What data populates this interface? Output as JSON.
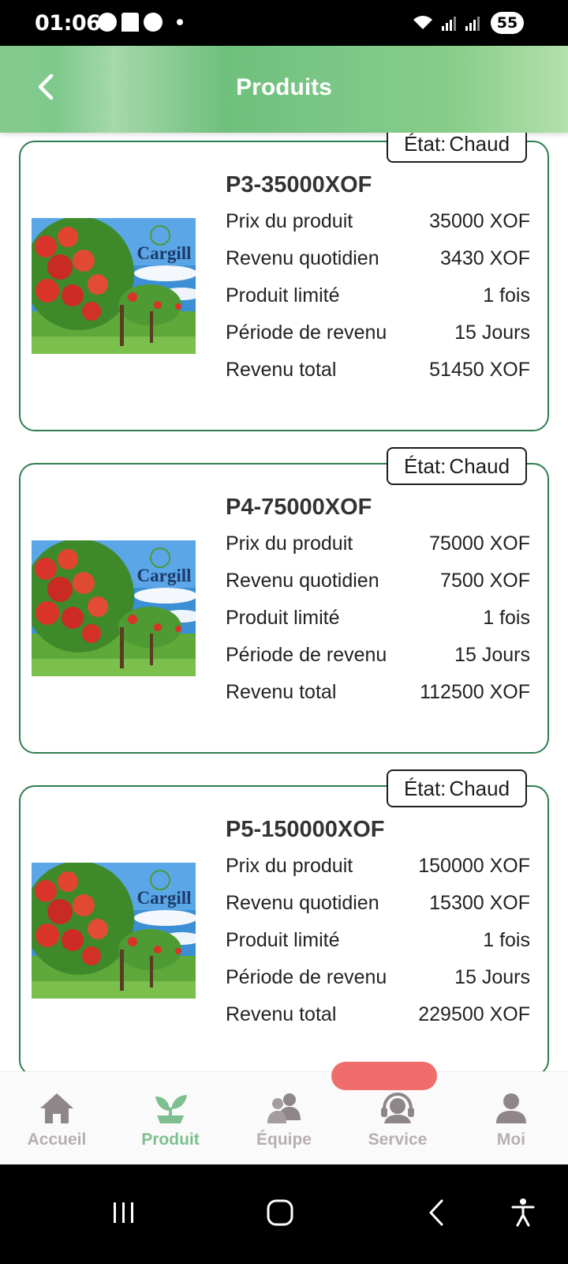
{
  "status_bar": {
    "time": "01:06",
    "battery": "55"
  },
  "header": {
    "title": "Produits"
  },
  "products": [
    {
      "name": "P3-35000XOF",
      "state_label": "État:",
      "state_value": "Chaud",
      "brand": "Cargill",
      "rows": [
        {
          "label": "Prix du produit",
          "value": "35000 XOF"
        },
        {
          "label": "Revenu quotidien",
          "value": "3430 XOF"
        },
        {
          "label": "Produit limité",
          "value": "1 fois"
        },
        {
          "label": "Période de revenu",
          "value": "15 Jours"
        },
        {
          "label": "Revenu total",
          "value": "51450 XOF"
        }
      ]
    },
    {
      "name": "P4-75000XOF",
      "state_label": "État:",
      "state_value": "Chaud",
      "brand": "Cargill",
      "rows": [
        {
          "label": "Prix du produit",
          "value": "75000 XOF"
        },
        {
          "label": "Revenu quotidien",
          "value": "7500 XOF"
        },
        {
          "label": "Produit limité",
          "value": "1 fois"
        },
        {
          "label": "Période de revenu",
          "value": "15 Jours"
        },
        {
          "label": "Revenu total",
          "value": "112500 XOF"
        }
      ]
    },
    {
      "name": "P5-150000XOF",
      "state_label": "État:",
      "state_value": "Chaud",
      "brand": "Cargill",
      "rows": [
        {
          "label": "Prix du produit",
          "value": "150000 XOF"
        },
        {
          "label": "Revenu quotidien",
          "value": "15300 XOF"
        },
        {
          "label": "Produit limité",
          "value": "1 fois"
        },
        {
          "label": "Période de revenu",
          "value": "15 Jours"
        },
        {
          "label": "Revenu total",
          "value": "229500 XOF"
        }
      ]
    }
  ],
  "bottom_nav": [
    {
      "label": "Accueil",
      "icon": "home-icon",
      "active": false
    },
    {
      "label": "Produit",
      "icon": "plant-icon",
      "active": true
    },
    {
      "label": "Équipe",
      "icon": "team-icon",
      "active": false
    },
    {
      "label": "Service",
      "icon": "headset-icon",
      "active": false
    },
    {
      "label": "Moi",
      "icon": "user-icon",
      "active": false
    }
  ],
  "colors": {
    "accent_green": "#7dbf8f",
    "card_border": "#2e7d4f",
    "inactive_nav": "#b8aeb1",
    "pill_red": "#ef6e6b"
  }
}
